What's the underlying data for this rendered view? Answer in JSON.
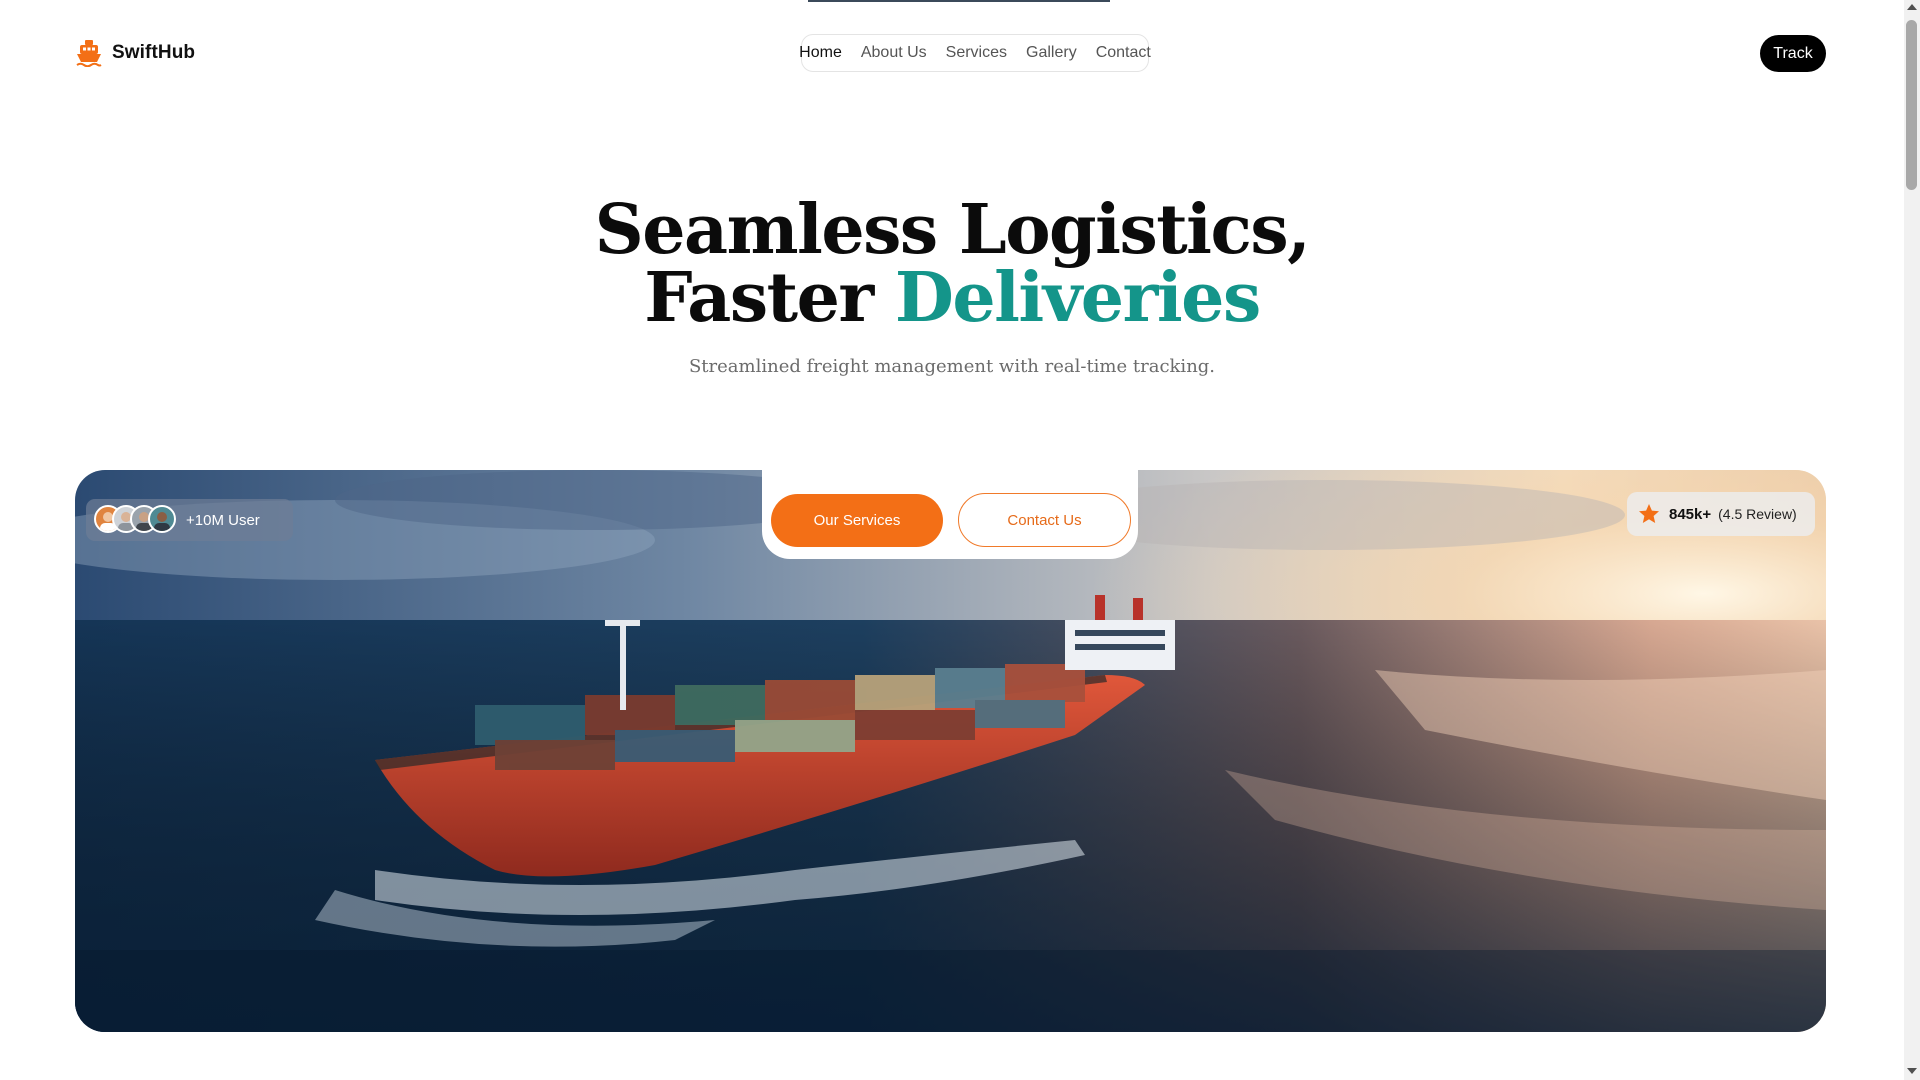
{
  "brand": {
    "name": "SwiftHub",
    "icon": "ship-icon",
    "accent_color": "#f36f16"
  },
  "nav": {
    "items": [
      {
        "label": "Home",
        "active": true
      },
      {
        "label": "About Us",
        "active": false
      },
      {
        "label": "Services",
        "active": false
      },
      {
        "label": "Gallery",
        "active": false
      },
      {
        "label": "Contact",
        "active": false
      }
    ]
  },
  "header": {
    "track_label": "Track"
  },
  "hero": {
    "title_line1": "Seamless Logistics,",
    "title_line2_plain": "Faster",
    "title_line2_accent": "Deliveries",
    "accent_color": "#14958a",
    "subtitle": "Streamlined freight management with real-time tracking.",
    "image_icon": "cargo-ship-image",
    "primary_cta": "Our Services",
    "secondary_cta": "Contact Us",
    "users_badge": {
      "label": "+10M User",
      "avatar_count": 4
    },
    "rating_badge": {
      "icon": "star-icon",
      "count": "845k+",
      "review": "(4.5 Review)"
    }
  }
}
